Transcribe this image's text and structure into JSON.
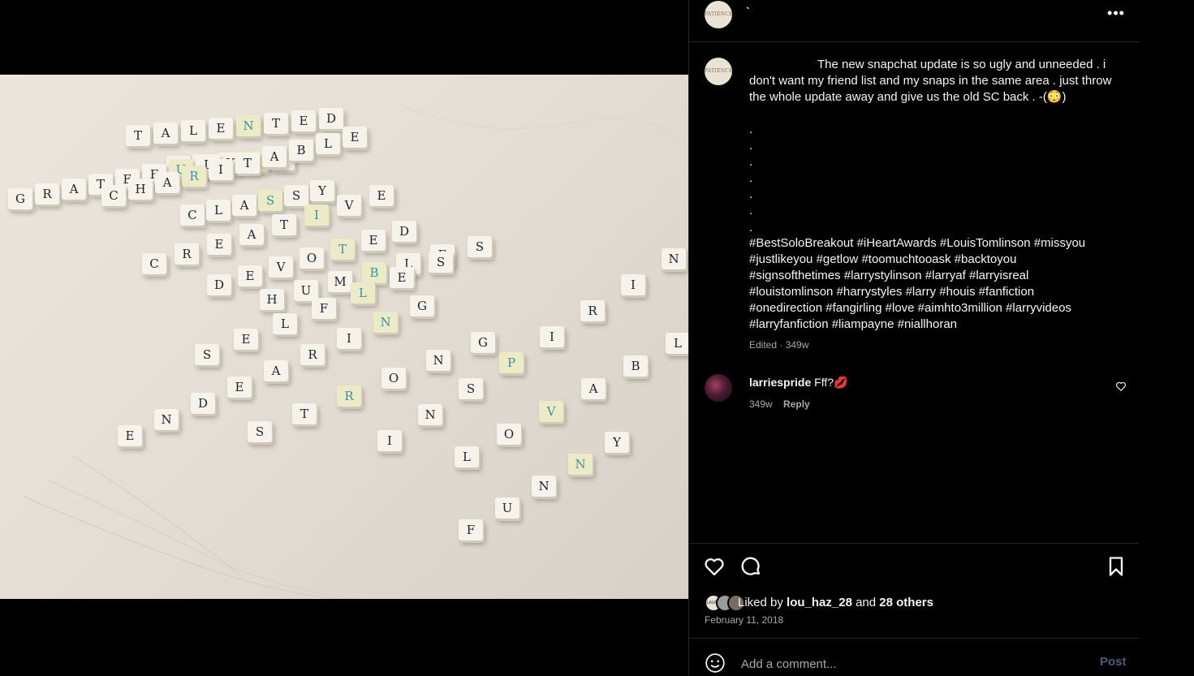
{
  "post": {
    "author_avatar_text": "PATIENCE",
    "author_name": "`",
    "more_label": "•••"
  },
  "caption": {
    "avatar_text": "PATIENCE",
    "text": "The new snapchat update is so ugly and unneeded . i don't want my friend list and my snaps in the same area . just throw the whole update away and give us the old SC back . -(😳)",
    "dots": ".\n.\n.\n.\n.\n.\n.",
    "hashtags": [
      "#BestSoloBreakout",
      "#iHeartAwards",
      "#LouisTomlinson",
      "#missyou",
      "#justlikeyou",
      "#getlow",
      "#toomuchtooask",
      "#backtoyou",
      "#signsofthetimes",
      "#larrystylinson",
      "#larryaf",
      "#larryisreal",
      "#louistomlinson",
      "#harrystyles",
      "#larry",
      "#houis",
      "#fanfiction",
      "#onedirection",
      "#fangirling",
      "#love",
      "#aimhto3million",
      "#larryvideos",
      "#larryfanfiction",
      "#liampayne",
      "#niallhoran"
    ],
    "meta": "Edited · 349w"
  },
  "comment": {
    "username": "larriespride",
    "text": "Fff?💋",
    "time": "349w",
    "reply_label": "Reply"
  },
  "likes": {
    "prefix": "Liked by",
    "user": "lou_haz_28",
    "and": "and",
    "others": "28 others",
    "avatar_texts": [
      "LAURA",
      "",
      ""
    ]
  },
  "date": "February 11, 2018",
  "comment_input": {
    "placeholder": "Add a comment...",
    "post_label": "Post"
  },
  "photo": {
    "tile_rows": [
      "TALENTED",
      "LOYAL",
      "GRATEFUL",
      "CHARITABLE",
      "CLASSY",
      "CREATIVE",
      "DEVOTED",
      "HUMBLE",
      "HUMBLENESS",
      "SELFLESS",
      "ENDEARING",
      "STRONG",
      "INSPIRING",
      "LOVABLE",
      "FUNNY"
    ]
  },
  "colors": {
    "accent_tile": "#3f8fa3",
    "post_button": "#4a5d7a",
    "secondary_text": "#a8a8a8"
  }
}
